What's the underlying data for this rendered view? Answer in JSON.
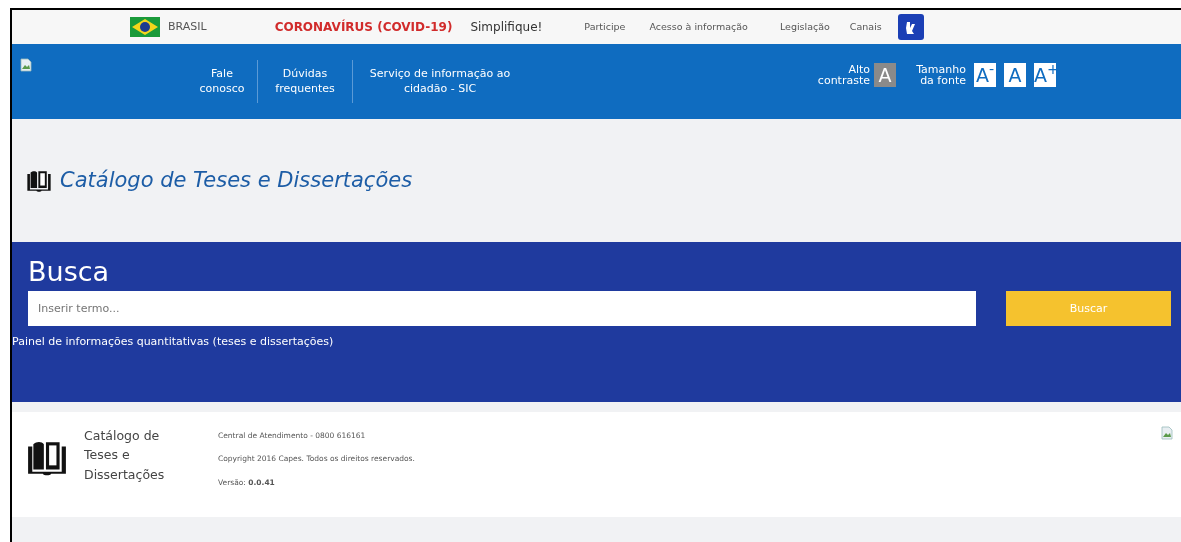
{
  "gov_bar": {
    "country": "BRASIL",
    "links": [
      {
        "text": "CORONAVÍRUS (COVID-19)",
        "kind": "alert"
      },
      {
        "text": "Simplifique!",
        "kind": "bold"
      },
      {
        "text": "Participe",
        "kind": "normal"
      },
      {
        "text": "Acesso à informação",
        "kind": "normal"
      },
      {
        "text": "Legislação",
        "kind": "normal"
      },
      {
        "text": "Canais",
        "kind": "normal"
      }
    ]
  },
  "header": {
    "nav": [
      "Fale conosco",
      "Dúvidas frequentes",
      "Serviço de informação ao cidadão - SIC"
    ],
    "contrast": {
      "label": "Alto contraste",
      "key": "A"
    },
    "font_size": {
      "label": "Tamanho da fonte",
      "buttons": [
        "A$^{-}$",
        "A",
        "A$^{+}$"
      ]
    }
  },
  "title": "Catálogo de Teses e Dissertações",
  "search": {
    "heading": "Busca",
    "placeholder": "Inserir termo...",
    "button": "Buscar",
    "link": "Painel de informações quantitativas (teses e dissertações)"
  },
  "footer": {
    "brand": "Catálogo de Teses e Dissertações",
    "lines": [
      "Central de Atendimento - 0800 616161",
      "Copyright 2016 Capes. Todos os direitos reservados."
    ],
    "version_label": "Versão:",
    "version": "0.0.41"
  }
}
